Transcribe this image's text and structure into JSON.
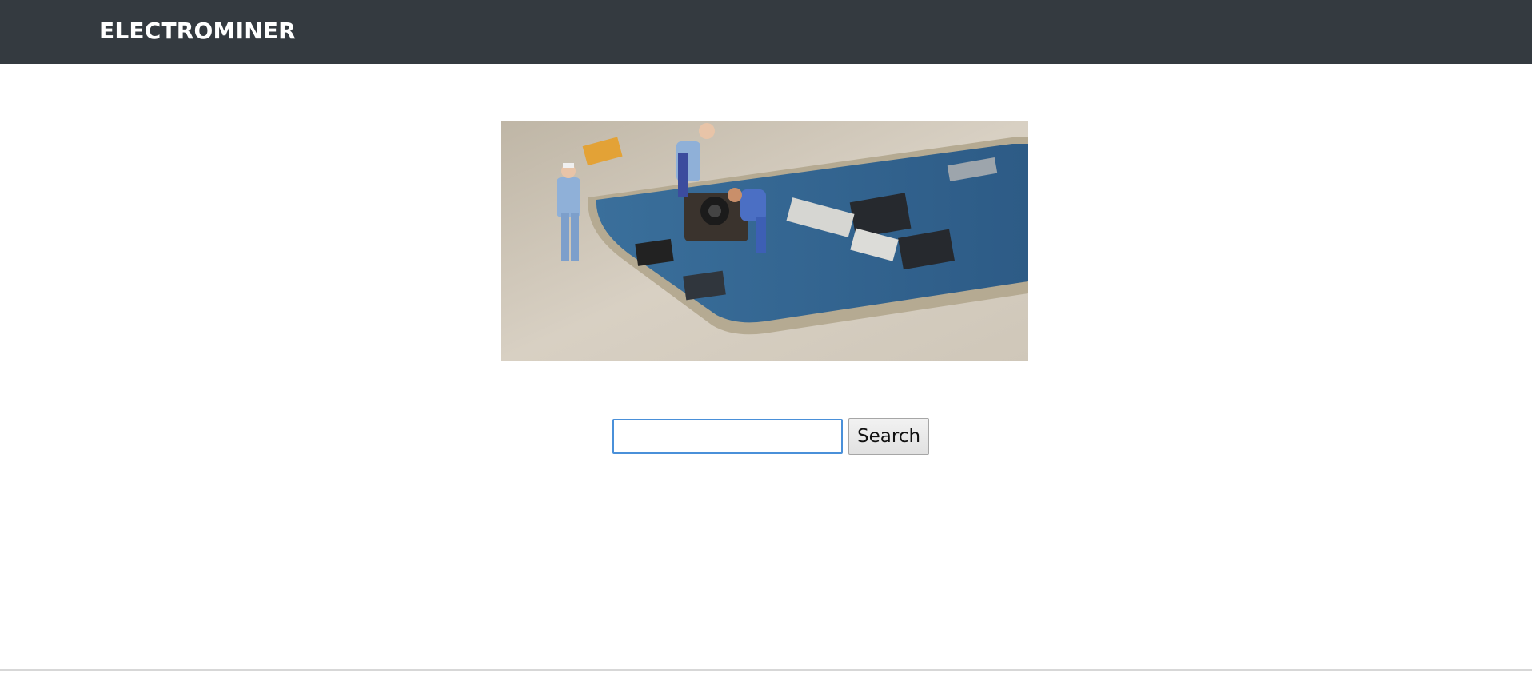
{
  "navbar": {
    "brand": "ELECTROMINER",
    "background_color": "#343a40"
  },
  "hero": {
    "alt": "Miniature workers repairing a smartphone circuit board"
  },
  "search": {
    "value": "",
    "placeholder": "",
    "button_label": "Search",
    "focus_color": "#4a90d9"
  }
}
